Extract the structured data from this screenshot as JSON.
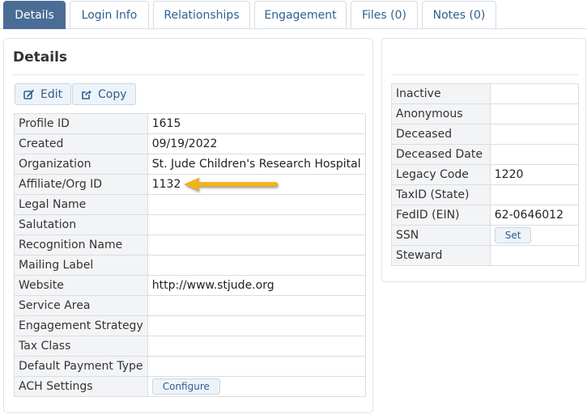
{
  "tabs": [
    {
      "label": "Details"
    },
    {
      "label": "Login Info"
    },
    {
      "label": "Relationships"
    },
    {
      "label": "Engagement"
    },
    {
      "label": "Files (0)"
    },
    {
      "label": "Notes (0)"
    }
  ],
  "details": {
    "title": "Details",
    "edit_label": "Edit",
    "copy_label": "Copy",
    "rows": [
      {
        "label": "Profile ID",
        "value": "1615"
      },
      {
        "label": "Created",
        "value": "09/19/2022"
      },
      {
        "label": "Organization",
        "value": "St. Jude Children's Research Hospital"
      },
      {
        "label": "Affiliate/Org ID",
        "value": "1132"
      },
      {
        "label": "Legal Name",
        "value": ""
      },
      {
        "label": "Salutation",
        "value": ""
      },
      {
        "label": "Recognition Name",
        "value": ""
      },
      {
        "label": "Mailing Label",
        "value": ""
      },
      {
        "label": "Website",
        "value": "http://www.stjude.org"
      },
      {
        "label": "Service Area",
        "value": ""
      },
      {
        "label": "Engagement Strategy",
        "value": ""
      },
      {
        "label": "Tax Class",
        "value": ""
      },
      {
        "label": "Default Payment Type",
        "value": ""
      },
      {
        "label": "ACH Settings",
        "button": "Configure"
      }
    ]
  },
  "side": {
    "rows": [
      {
        "label": "Inactive",
        "value": ""
      },
      {
        "label": "Anonymous",
        "value": ""
      },
      {
        "label": "Deceased",
        "value": ""
      },
      {
        "label": "Deceased Date",
        "value": ""
      },
      {
        "label": "Legacy Code",
        "value": "1220"
      },
      {
        "label": "TaxID (State)",
        "value": ""
      },
      {
        "label": "FedID (EIN)",
        "value": "62-0646012"
      },
      {
        "label": "SSN",
        "button": "Set"
      },
      {
        "label": "Steward",
        "value": ""
      }
    ]
  },
  "colors": {
    "active_tab": "#4a6d95",
    "link": "#2e6ba8",
    "annotation_arrow": "#f2b416"
  },
  "icons": {
    "edit": "edit-icon",
    "copy": "share-icon",
    "annotation": "arrow-left-icon"
  }
}
